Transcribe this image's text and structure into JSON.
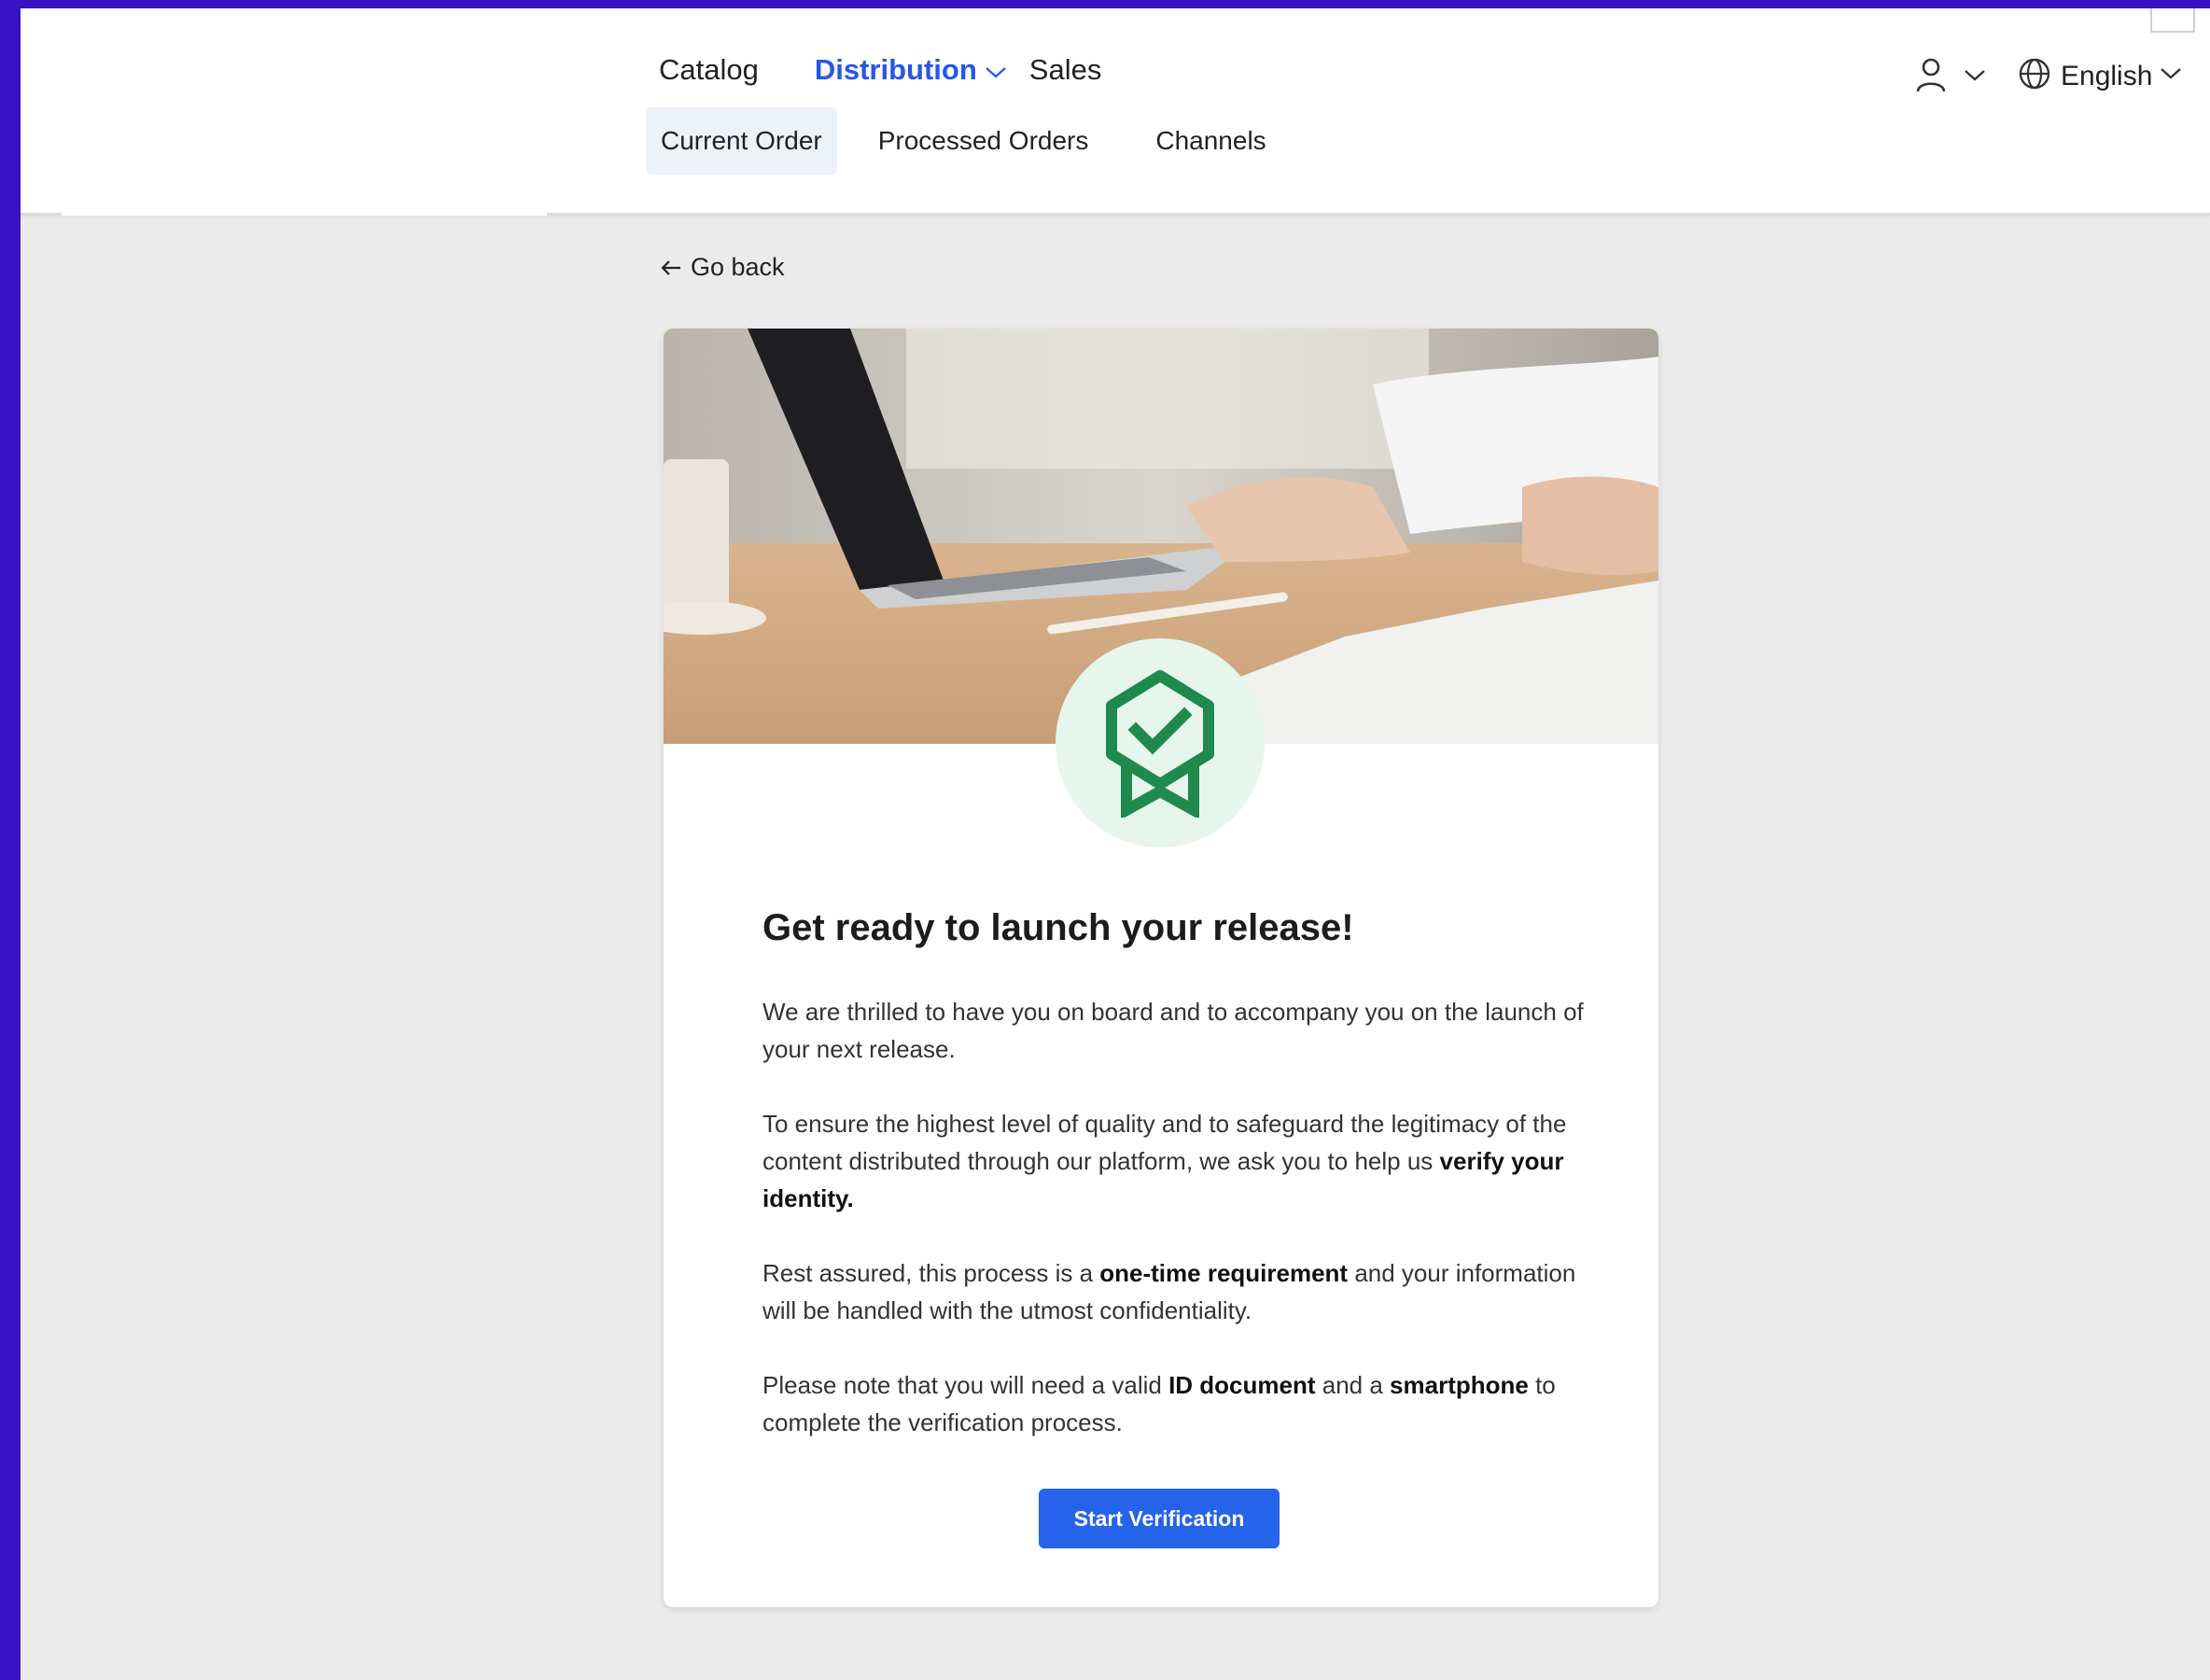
{
  "nav": {
    "primary": [
      {
        "label": "Catalog",
        "active": false
      },
      {
        "label": "Distribution",
        "active": true
      },
      {
        "label": "Sales",
        "active": false
      }
    ],
    "secondary": [
      {
        "label": "Current Order",
        "active": true
      },
      {
        "label": "Processed Orders",
        "active": false
      },
      {
        "label": "Channels",
        "active": false
      }
    ],
    "language": "English"
  },
  "go_back": "Go back",
  "card": {
    "title": "Get ready to launch your release!",
    "p1": "We are thrilled to have you on board and to accompany you on the launch of your next release.",
    "p2_pre": "To ensure the highest level of quality and to safeguard the legitimacy of the content distributed through our platform, we ask you to help us ",
    "p2_bold": "verify your identity.",
    "p3_pre": "Rest assured, this process is a ",
    "p3_bold": "one-time requirement",
    "p3_post": " and your information will be handled with the utmost confidentiality.",
    "p4_pre": "Please note that you will need a valid ",
    "p4_bold1": "ID document",
    "p4_mid": " and a ",
    "p4_bold2": "smartphone",
    "p4_post": " to complete the verification process.",
    "button": "Start Verification"
  },
  "colors": {
    "accent": "#2557e8",
    "button": "#2563eb",
    "badge_green": "#1f8a4c",
    "badge_bg": "#e7f6ec",
    "frame": "#3a12c4"
  },
  "icons": {
    "user": "user-icon",
    "globe": "globe-icon",
    "back": "arrow-left-icon",
    "badge": "verified-badge-icon"
  }
}
